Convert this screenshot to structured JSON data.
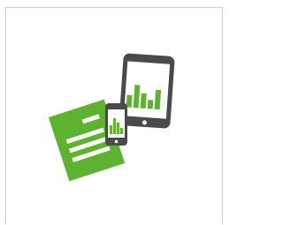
{
  "card": {
    "illustration_name": "documents-and-mobile-devices",
    "icons": [
      "document-icon",
      "smartphone-icon",
      "tablet-icon",
      "bar-chart-icon"
    ]
  },
  "colors": {
    "border": "#cfcfcf",
    "background": "#ffffff",
    "green": "#5db230",
    "device": "#4a4a4a",
    "screen": "#ffffff"
  }
}
